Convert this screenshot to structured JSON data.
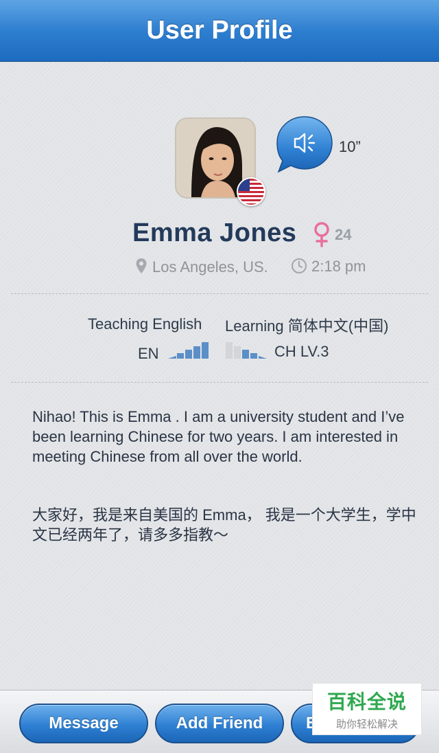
{
  "header": {
    "title": "User Profile"
  },
  "profile": {
    "name": "Emma Jones",
    "age": "24",
    "gender_icon": "female-symbol-icon",
    "location": "Los Angeles, US.",
    "local_time": "2:18 pm",
    "voice_intro_duration": "10”",
    "flag": "us-flag-icon"
  },
  "languages": {
    "teaching_label": "Teaching English",
    "teaching_code": "EN",
    "teaching_level_bars": 5,
    "learning_label": "Learning 简体中文(中国)",
    "learning_code": "CH LV.3",
    "learning_level_bars": 3
  },
  "bio": {
    "english": "Nihao! This is Emma . I am a university student and I’ve been learning Chinese for two years. I am interested in meeting Chinese from all over the world.",
    "chinese": "大家好，我是来自美国的 Emma， 我是一个大学生，学中文已经两年了，请多多指教～"
  },
  "actions": {
    "message_label": "Message",
    "add_friend_label": "Add Friend",
    "third_label": "B"
  },
  "watermark": {
    "main": "百科全说",
    "sub": "助你轻松解决"
  },
  "colors": {
    "nav_blue": "#2f7fd0",
    "name_navy": "#233a5a",
    "gender_pink": "#e8709a",
    "level_blue": "#5b8fc7",
    "watermark_green": "#2fa84f"
  }
}
